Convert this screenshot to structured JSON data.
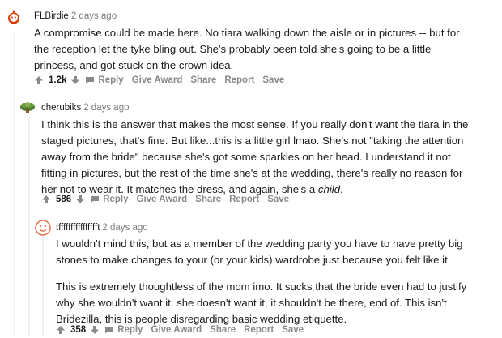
{
  "comments": [
    {
      "author": "FLBirdie",
      "time": "2 days ago",
      "paragraphs": [
        "A compromise could be made here. No tiara walking down the aisle or in pictures -- but for the reception let the tyke bling out. She's probably been told she's going to be a little princess, and got stuck on the crown idea."
      ],
      "score": "1.2k"
    },
    {
      "author": "cherubiks",
      "time": "2 days ago",
      "paragraphs": [
        "I think this is the answer that makes the most sense. If you really don't want the tiara in the staged pictures, that's fine. But like...this is a little girl lmao. She's not \"taking the attention away from the bride\" because she's got some sparkles on her head. I understand it not fitting in pictures, but the rest of the time she's at the wedding, there's really no reason for her not to wear it. It matches the dress, and again, she's a ",
        "child",
        "."
      ],
      "score": "586"
    },
    {
      "author": "tfffffffffffffffft",
      "time": "2 days ago",
      "paragraphs": [
        "I wouldn't mind this, but as a member of the wedding party you have to have pretty big stones to make changes to your (or your kids) wardrobe just because you felt like it.",
        "This is extremely thoughtless of the mom imo. It sucks that the bride even had to justify why she wouldn't want it, she doesn't want it, it shouldn't be there, end of. This isn't Bridezilla, this is people disregarding basic wedding etiquette."
      ],
      "score": "358"
    }
  ],
  "actions": {
    "reply": "Reply",
    "give_award": "Give Award",
    "share": "Share",
    "report": "Report",
    "save": "Save"
  },
  "colors": {
    "text": "#1a1a1b",
    "muted": "#787c7e",
    "action": "#878a8c",
    "thread_line": "#edeff1"
  },
  "icons": [
    "snoo-avatar-icon",
    "succulent-avatar-icon",
    "smiley-avatar-icon",
    "upvote-arrow-icon",
    "downvote-arrow-icon",
    "reply-bubble-icon"
  ]
}
